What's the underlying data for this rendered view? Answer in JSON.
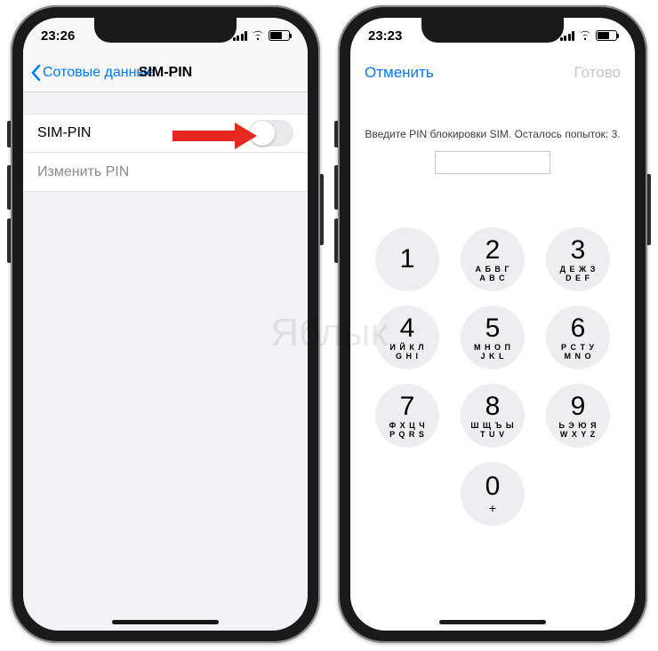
{
  "watermark": "Яблык",
  "left": {
    "status_time": "23:26",
    "back_label": "Сотовые данные",
    "title": "SIM-PIN",
    "rows": {
      "sim_pin": "SIM-PIN",
      "change_pin": "Изменить PIN"
    }
  },
  "right": {
    "status_time": "23:23",
    "cancel": "Отменить",
    "done": "Готово",
    "prompt": "Введите PIN блокировки SIM. Осталось попыток: 3.",
    "keys": [
      {
        "d": "1",
        "l": ""
      },
      {
        "d": "2",
        "l": "А Б В Г\nA B C"
      },
      {
        "d": "3",
        "l": "Д Е Ж З\nD E F"
      },
      {
        "d": "4",
        "l": "И Й К Л\nG H I"
      },
      {
        "d": "5",
        "l": "М Н О П\nJ K L"
      },
      {
        "d": "6",
        "l": "Р С Т У\nM N O"
      },
      {
        "d": "7",
        "l": "Ф Х Ц Ч\nP Q R S"
      },
      {
        "d": "8",
        "l": "Ш Щ Ъ Ы\nT U V"
      },
      {
        "d": "9",
        "l": "Ь Э Ю Я\nW X Y Z"
      },
      {
        "d": "0",
        "l": "+"
      }
    ]
  }
}
